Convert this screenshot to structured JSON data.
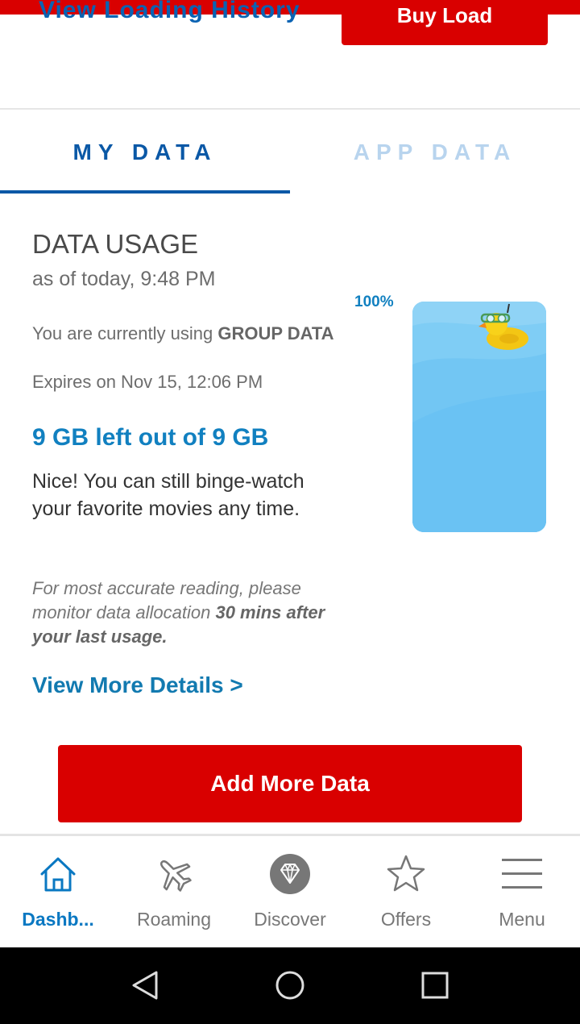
{
  "top": {
    "link_label": "View Loading History",
    "button_label": "Buy Load"
  },
  "tabs": [
    {
      "label": "MY DATA",
      "active": true
    },
    {
      "label": "APP DATA",
      "active": false
    }
  ],
  "usage": {
    "title": "DATA USAGE",
    "as_of": "as of today, 9:48 PM",
    "group_prefix": "You are currently using ",
    "group_name": "GROUP DATA",
    "expires": "Expires on Nov 15, 12:06 PM",
    "left_out": "9 GB left out of 9 GB",
    "message": "Nice! You can still binge-watch your favorite movies any time.",
    "note_line": "For most accurate reading, please monitor data allocation ",
    "note_strong": "30 mins after your last usage.",
    "view_more": "View More Details >",
    "gauge_percent_label": "100%",
    "gauge_fill_fraction": 1.0
  },
  "add_button": "Add More Data",
  "nav": [
    {
      "label": "Dashb...",
      "icon": "home-icon",
      "active": true
    },
    {
      "label": "Roaming",
      "icon": "airplane-icon",
      "active": false
    },
    {
      "label": "Discover",
      "icon": "diamond-icon",
      "active": false
    },
    {
      "label": "Offers",
      "icon": "star-icon",
      "active": false
    },
    {
      "label": "Menu",
      "icon": "hamburger-menu-icon",
      "active": false
    }
  ],
  "colors": {
    "brand_red": "#d90000",
    "brand_blue": "#0a58a6",
    "accent_blue": "#1180c0",
    "water_blue": "#6ec5f3"
  }
}
